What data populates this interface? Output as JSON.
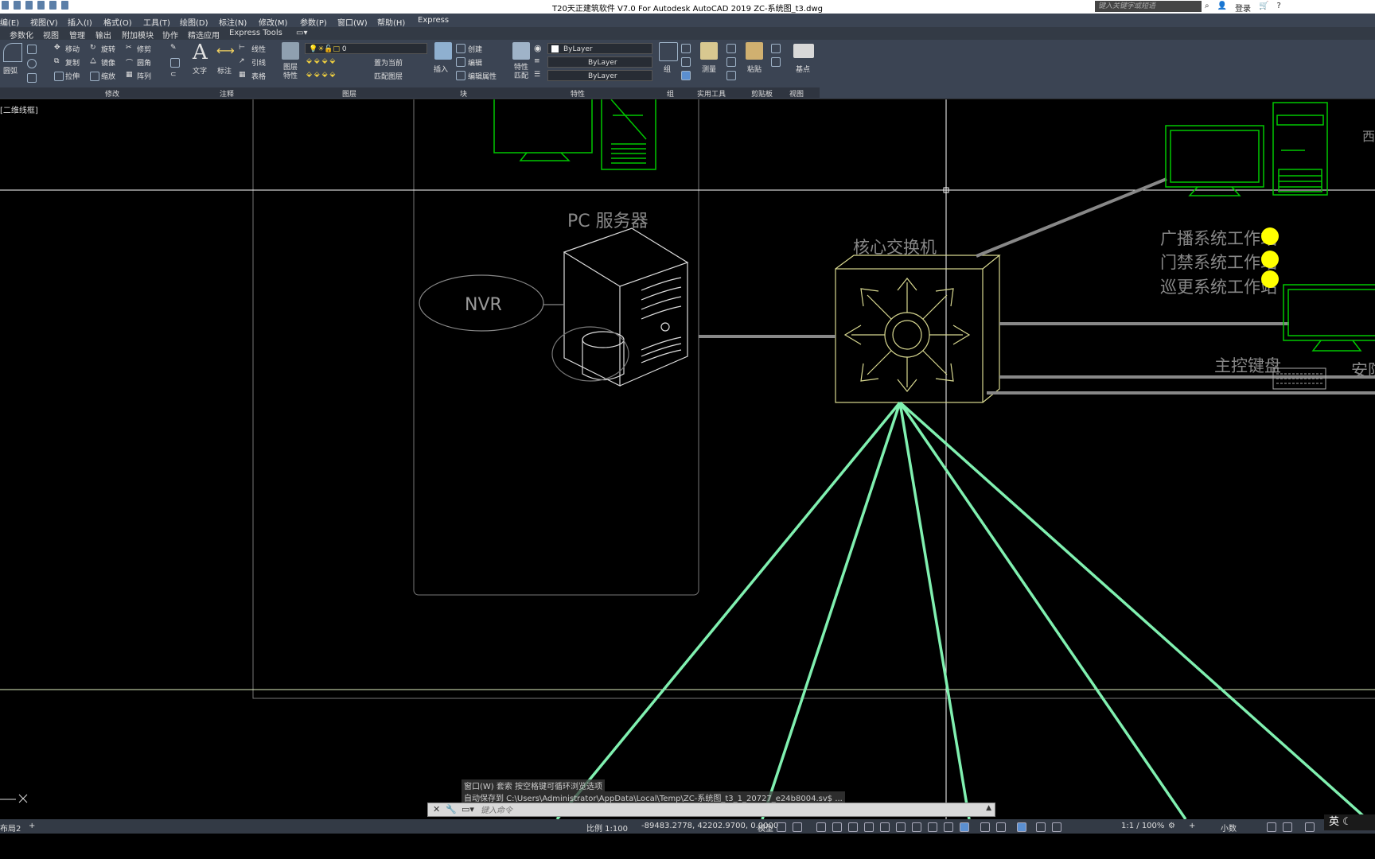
{
  "title": "T20天正建筑软件 V7.0 For Autodesk AutoCAD 2019    ZC-系统图_t3.dwg",
  "search_placeholder": "键入关键字或短语",
  "login_label": "登录",
  "menu": [
    "编(E)",
    "视图(V)",
    "插入(I)",
    "格式(O)",
    "工具(T)",
    "绘图(D)",
    "标注(N)",
    "修改(M)",
    "参数(P)",
    "窗口(W)",
    "帮助(H)",
    "Express"
  ],
  "tabs": [
    "参数化",
    "视图",
    "管理",
    "输出",
    "附加模块",
    "协作",
    "精选应用",
    "Express Tools"
  ],
  "ribbon": {
    "modify": {
      "label": "修改",
      "items": [
        "移动",
        "旋转",
        "修剪",
        "复制",
        "镜像",
        "圆角",
        "拉伸",
        "缩放",
        "阵列"
      ]
    },
    "draw_label": "圆弧",
    "annotation": {
      "label": "注释",
      "text": "文字",
      "dim": "标注",
      "linear": "线性",
      "leader": "引线",
      "table": "表格"
    },
    "layers": {
      "label": "图层",
      "props": "图层特性",
      "current_layer": "0",
      "set_current": "置为当前",
      "match_layer": "匹配图层"
    },
    "block": {
      "label": "块",
      "insert": "插入",
      "create": "创建",
      "edit": "编辑",
      "edit_attr": "编辑属性"
    },
    "properties": {
      "label": "特性",
      "match": "特性匹配",
      "color": "ByLayer",
      "linetype": "ByLayer",
      "lineweight": "ByLayer"
    },
    "groups": {
      "label": "组",
      "group": "组"
    },
    "utilities": {
      "label": "实用工具",
      "measure": "测量"
    },
    "clipboard": {
      "label": "剪贴板",
      "paste": "粘贴"
    },
    "view": {
      "label": "视图",
      "base": "基点"
    }
  },
  "viewport_label": "[二维线框]",
  "drawing": {
    "pc_server_label": "PC  服务器",
    "nvr_label": "NVR",
    "core_switch_label": "核心交换机",
    "workstations": [
      "广播系统工作站",
      "门禁系统工作站",
      "巡更系统工作站"
    ],
    "keyboard_label": "主控键盘",
    "security_label": "安防",
    "west_label": "西",
    "colors": {
      "green": "#00c800",
      "yellow": "#ffff00",
      "switch": "#d8d890",
      "trunk": "#80f0b0",
      "gray": "#888888"
    }
  },
  "command": {
    "history_1": "窗口(W) 套索  按空格键可循环浏览选项",
    "history_2": "自动保存到 C:\\Users\\Administrator\\AppData\\Local\\Temp\\ZC-系统图_t3_1_20727_e24b8004.sv$ ...",
    "placeholder": "键入命令"
  },
  "status": {
    "layout_tab": "布局2",
    "scale": "比例 1:100",
    "coords": "-89483.2778, 42202.9700, 0.0000",
    "model": "模型",
    "annotation_scale": "1:1 / 100%",
    "units": "小数"
  },
  "ime": "英"
}
